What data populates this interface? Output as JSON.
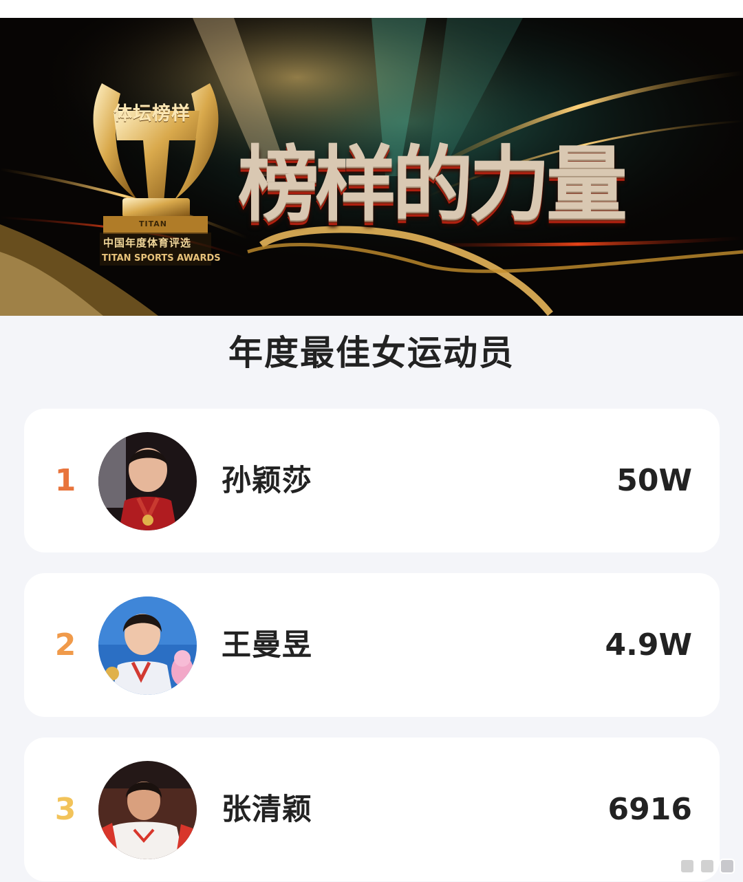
{
  "banner": {
    "logo_wordmark": "体坛榜样",
    "logo_cn": "中国年度体育评选",
    "logo_en": "TITAN SPORTS AWARDS",
    "logo_titan": "TITAN",
    "headline": "榜样的力量"
  },
  "section_title": "年度最佳女运动员",
  "ranking": [
    {
      "rank": "1",
      "name": "孙颖莎",
      "value": "50W",
      "rank_color": "#e8743c"
    },
    {
      "rank": "2",
      "name": "王曼昱",
      "value": "4.9W",
      "rank_color": "#f09a4a"
    },
    {
      "rank": "3",
      "name": "张清颖",
      "value": "6916",
      "rank_color": "#f2c35a"
    }
  ],
  "colors": {
    "page_bg": "#f4f5f9",
    "card_bg": "#ffffff",
    "text": "#222222",
    "gold": "#e0b35a"
  }
}
